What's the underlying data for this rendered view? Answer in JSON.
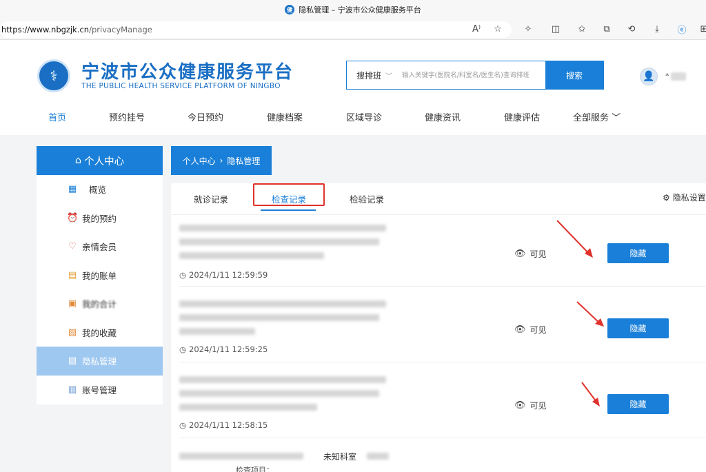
{
  "browser": {
    "tab_title": "隐私管理 – 宁波市公众健康服务平台",
    "url_host": "https://www.nbgzjk.cn",
    "url_path": "/privacyManage"
  },
  "site": {
    "title": "宁波市公众健康服务平台",
    "subtitle": "THE PUBLIC HEALTH SERVICE PLATFORM OF NINGBO",
    "search_type": "搜排班",
    "search_placeholder": "输入关键字(医院名/科室名/医生名)查询排班",
    "search_button": "搜索",
    "username": "*"
  },
  "nav": [
    "首页",
    "预约挂号",
    "今日预约",
    "健康档案",
    "区域导诊",
    "健康资讯",
    "健康评估",
    "全部服务"
  ],
  "sidebar": {
    "header": "个人中心",
    "items": [
      {
        "label": "概览",
        "icon": "grid-icon"
      },
      {
        "label": "我的预约",
        "icon": "clock-icon"
      },
      {
        "label": "亲情会员",
        "icon": "heart-icon"
      },
      {
        "label": "我的账单",
        "icon": "bill-icon"
      },
      {
        "label": "我的合计",
        "icon": "wallet-icon"
      },
      {
        "label": "我的收藏",
        "icon": "star-icon"
      },
      {
        "label": "隐私管理",
        "icon": "shield-icon"
      },
      {
        "label": "账号管理",
        "icon": "user-card-icon"
      }
    ]
  },
  "breadcrumb": {
    "root": "个人中心",
    "current": "隐私管理"
  },
  "tabs": [
    "就诊记录",
    "检查记录",
    "检验记录"
  ],
  "privacy_settings": "隐私设置",
  "records": [
    {
      "time": "2024/1/11 12:59:59",
      "status": "可见",
      "action": "隐藏"
    },
    {
      "time": "2024/1/11 12:59:25",
      "status": "可见",
      "action": "隐藏"
    },
    {
      "time": "2024/1/11 12:58:15",
      "status": "可见",
      "action": "隐藏"
    }
  ],
  "partial_record": {
    "dept": "未知科室",
    "item_label": "检查项目："
  },
  "colors": {
    "primary": "#1a7fd8",
    "highlight": "#e0322c",
    "sidebar_active": "#9ec8f0"
  }
}
